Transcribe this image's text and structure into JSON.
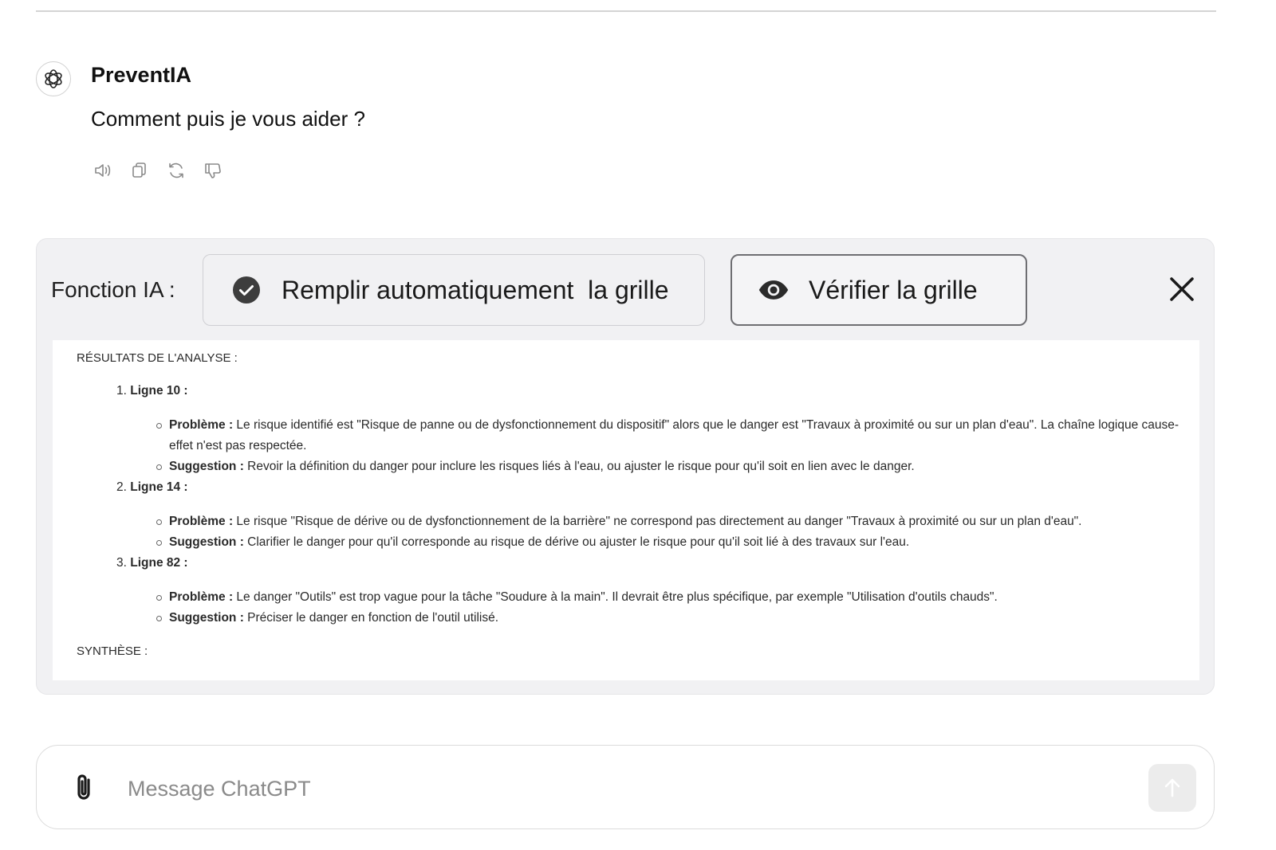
{
  "assistant": {
    "name": "PreventIA",
    "message": "Comment puis je vous aider ?",
    "actions": [
      {
        "icon": "speaker-icon"
      },
      {
        "icon": "copy-icon"
      },
      {
        "icon": "regenerate-icon"
      },
      {
        "icon": "thumbs-down-icon"
      }
    ]
  },
  "ai_panel": {
    "label": "Fonction IA :",
    "fill_button": {
      "label": "Remplir automatiquement  la grille",
      "icon": "check-circle-icon"
    },
    "verify_button": {
      "label": "Vérifier la grille",
      "icon": "eye-icon"
    },
    "close_icon": "close-icon",
    "analysis": {
      "heading": "RÉSULTATS DE L'ANALYSE :",
      "findings": [
        {
          "num": "1.",
          "title": "Ligne 10 :",
          "problem_label": "Problème :",
          "problem": "Le risque identifié est \"Risque de panne ou de dysfonctionnement du dispositif\" alors que le danger est \"Travaux à proximité ou sur un plan d'eau\". La chaîne logique cause-effet n'est pas respectée.",
          "suggestion_label": "Suggestion :",
          "suggestion": "Revoir la définition du danger pour inclure les risques liés à l'eau, ou ajuster le risque pour qu'il soit en lien avec le danger."
        },
        {
          "num": "2.",
          "title": "Ligne 14 :",
          "problem_label": "Problème :",
          "problem": "Le risque \"Risque de dérive ou de dysfonctionnement de la barrière\" ne correspond pas directement au danger \"Travaux à proximité ou sur un plan d'eau\".",
          "suggestion_label": "Suggestion :",
          "suggestion": "Clarifier le danger pour qu'il corresponde au risque de dérive ou ajuster le risque pour qu'il soit lié à des travaux sur l'eau."
        },
        {
          "num": "3.",
          "title": "Ligne 82 :",
          "problem_label": "Problème :",
          "problem": "Le danger \"Outils\" est trop vague pour la tâche \"Soudure à la main\". Il devrait être plus spécifique, par exemple \"Utilisation d'outils chauds\".",
          "suggestion_label": "Suggestion :",
          "suggestion": "Préciser le danger en fonction de l'outil utilisé."
        }
      ],
      "synthesis": "SYNTHÈSE :"
    }
  },
  "composer": {
    "placeholder": "Message ChatGPT",
    "attach_icon": "paperclip-icon",
    "send_icon": "arrow-up-icon"
  }
}
